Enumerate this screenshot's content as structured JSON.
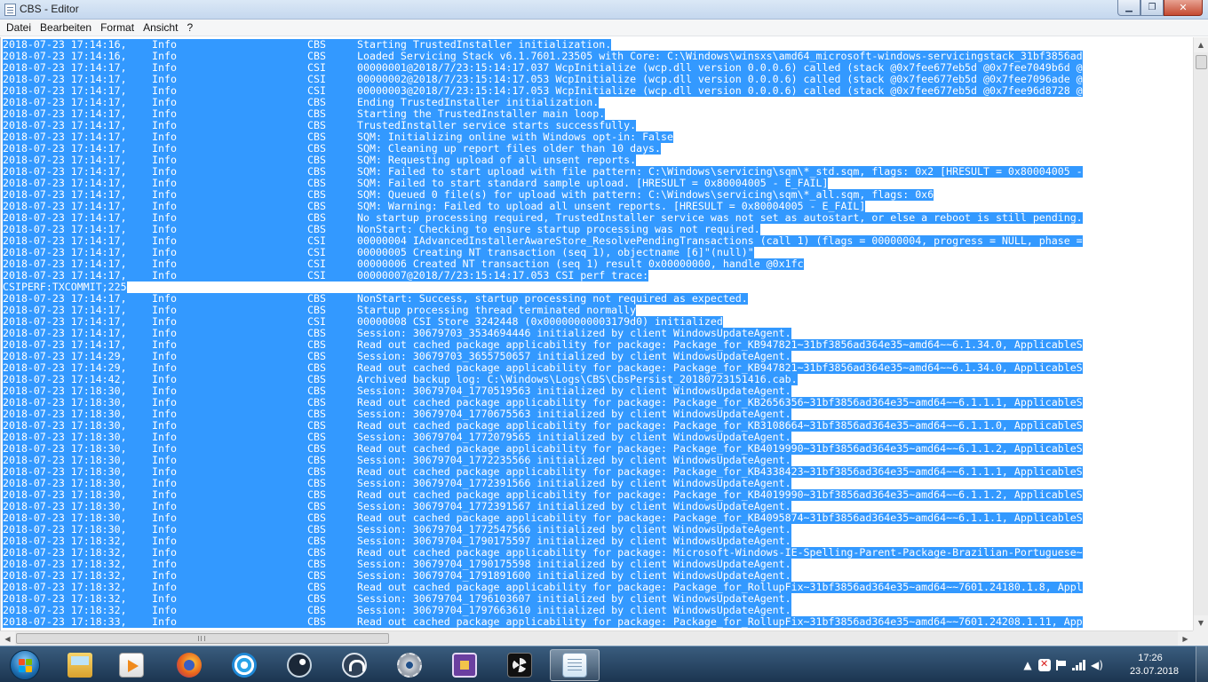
{
  "window": {
    "title": "CBS - Editor",
    "minimize_glyph": "▁",
    "maximize_glyph": "❐",
    "close_glyph": "✕"
  },
  "menu": {
    "items": [
      "Datei",
      "Bearbeiten",
      "Format",
      "Ansicht",
      "?"
    ]
  },
  "editor": {
    "selection_color": "#3399ff",
    "lines": [
      {
        "t": "2018-07-23 17:14:16,",
        "l": "Info",
        "c": "CBS",
        "m": "Starting TrustedInstaller initialization."
      },
      {
        "t": "2018-07-23 17:14:16,",
        "l": "Info",
        "c": "CBS",
        "m": "Loaded Servicing Stack v6.1.7601.23505 with Core: C:\\Windows\\winsxs\\amd64_microsoft-windows-servicingstack_31bf3856ad"
      },
      {
        "t": "2018-07-23 17:14:17,",
        "l": "Info",
        "c": "CSI",
        "m": "00000001@2018/7/23:15:14:17.037 WcpInitialize (wcp.dll version 0.0.0.6) called (stack @0x7fee677eb5d @0x7fee7049b6d @"
      },
      {
        "t": "2018-07-23 17:14:17,",
        "l": "Info",
        "c": "CSI",
        "m": "00000002@2018/7/23:15:14:17.053 WcpInitialize (wcp.dll version 0.0.0.6) called (stack @0x7fee677eb5d @0x7fee7096ade @"
      },
      {
        "t": "2018-07-23 17:14:17,",
        "l": "Info",
        "c": "CSI",
        "m": "00000003@2018/7/23:15:14:17.053 WcpInitialize (wcp.dll version 0.0.0.6) called (stack @0x7fee677eb5d @0x7fee96d8728 @"
      },
      {
        "t": "2018-07-23 17:14:17,",
        "l": "Info",
        "c": "CBS",
        "m": "Ending TrustedInstaller initialization."
      },
      {
        "t": "2018-07-23 17:14:17,",
        "l": "Info",
        "c": "CBS",
        "m": "Starting the TrustedInstaller main loop."
      },
      {
        "t": "2018-07-23 17:14:17,",
        "l": "Info",
        "c": "CBS",
        "m": "TrustedInstaller service starts successfully."
      },
      {
        "t": "2018-07-23 17:14:17,",
        "l": "Info",
        "c": "CBS",
        "m": "SQM: Initializing online with Windows opt-in: False"
      },
      {
        "t": "2018-07-23 17:14:17,",
        "l": "Info",
        "c": "CBS",
        "m": "SQM: Cleaning up report files older than 10 days."
      },
      {
        "t": "2018-07-23 17:14:17,",
        "l": "Info",
        "c": "CBS",
        "m": "SQM: Requesting upload of all unsent reports."
      },
      {
        "t": "2018-07-23 17:14:17,",
        "l": "Info",
        "c": "CBS",
        "m": "SQM: Failed to start upload with file pattern: C:\\Windows\\servicing\\sqm\\*_std.sqm, flags: 0x2 [HRESULT = 0x80004005 -"
      },
      {
        "t": "2018-07-23 17:14:17,",
        "l": "Info",
        "c": "CBS",
        "m": "SQM: Failed to start standard sample upload. [HRESULT = 0x80004005 - E_FAIL]"
      },
      {
        "t": "2018-07-23 17:14:17,",
        "l": "Info",
        "c": "CBS",
        "m": "SQM: Queued 0 file(s) for upload with pattern: C:\\Windows\\servicing\\sqm\\*_all.sqm, flags: 0x6"
      },
      {
        "t": "2018-07-23 17:14:17,",
        "l": "Info",
        "c": "CBS",
        "m": "SQM: Warning: Failed to upload all unsent reports. [HRESULT = 0x80004005 - E_FAIL]"
      },
      {
        "t": "2018-07-23 17:14:17,",
        "l": "Info",
        "c": "CBS",
        "m": "No startup processing required, TrustedInstaller service was not set as autostart, or else a reboot is still pending."
      },
      {
        "t": "2018-07-23 17:14:17,",
        "l": "Info",
        "c": "CBS",
        "m": "NonStart: Checking to ensure startup processing was not required."
      },
      {
        "t": "2018-07-23 17:14:17,",
        "l": "Info",
        "c": "CSI",
        "m": "00000004 IAdvancedInstallerAwareStore_ResolvePendingTransactions (call 1) (flags = 00000004, progress = NULL, phase ="
      },
      {
        "t": "2018-07-23 17:14:17,",
        "l": "Info",
        "c": "CSI",
        "m": "00000005 Creating NT transaction (seq 1), objectname [6]\"(null)\""
      },
      {
        "t": "2018-07-23 17:14:17,",
        "l": "Info",
        "c": "CSI",
        "m": "00000006 Created NT transaction (seq 1) result 0x00000000, handle @0x1fc"
      },
      {
        "t": "2018-07-23 17:14:17,",
        "l": "Info",
        "c": "CSI",
        "m": "00000007@2018/7/23:15:14:17.053 CSI perf trace:"
      },
      {
        "raw": "CSIPERF:TXCOMMIT;225"
      },
      {
        "t": "2018-07-23 17:14:17,",
        "l": "Info",
        "c": "CBS",
        "m": "NonStart: Success, startup processing not required as expected."
      },
      {
        "t": "2018-07-23 17:14:17,",
        "l": "Info",
        "c": "CBS",
        "m": "Startup processing thread terminated normally"
      },
      {
        "t": "2018-07-23 17:14:17,",
        "l": "Info",
        "c": "CSI",
        "m": "00000008 CSI Store 3242448 (0x00000000003179d0) initialized"
      },
      {
        "t": "2018-07-23 17:14:17,",
        "l": "Info",
        "c": "CBS",
        "m": "Session: 30679703_3534694446 initialized by client WindowsUpdateAgent."
      },
      {
        "t": "2018-07-23 17:14:17,",
        "l": "Info",
        "c": "CBS",
        "m": "Read out cached package applicability for package: Package_for_KB947821~31bf3856ad364e35~amd64~~6.1.34.0, ApplicableS"
      },
      {
        "t": "2018-07-23 17:14:29,",
        "l": "Info",
        "c": "CBS",
        "m": "Session: 30679703_3655750657 initialized by client WindowsUpdateAgent."
      },
      {
        "t": "2018-07-23 17:14:29,",
        "l": "Info",
        "c": "CBS",
        "m": "Read out cached package applicability for package: Package_for_KB947821~31bf3856ad364e35~amd64~~6.1.34.0, ApplicableS"
      },
      {
        "t": "2018-07-23 17:14:42,",
        "l": "Info",
        "c": "CBS",
        "m": "Archived backup log: C:\\Windows\\Logs\\CBS\\CbsPersist_20180723151416.cab."
      },
      {
        "t": "2018-07-23 17:18:30,",
        "l": "Info",
        "c": "CBS",
        "m": "Session: 30679704_1770519563 initialized by client WindowsUpdateAgent."
      },
      {
        "t": "2018-07-23 17:18:30,",
        "l": "Info",
        "c": "CBS",
        "m": "Read out cached package applicability for package: Package_for_KB2656356~31bf3856ad364e35~amd64~~6.1.1.1, ApplicableS"
      },
      {
        "t": "2018-07-23 17:18:30,",
        "l": "Info",
        "c": "CBS",
        "m": "Session: 30679704_1770675563 initialized by client WindowsUpdateAgent."
      },
      {
        "t": "2018-07-23 17:18:30,",
        "l": "Info",
        "c": "CBS",
        "m": "Read out cached package applicability for package: Package_for_KB3108664~31bf3856ad364e35~amd64~~6.1.1.0, ApplicableS"
      },
      {
        "t": "2018-07-23 17:18:30,",
        "l": "Info",
        "c": "CBS",
        "m": "Session: 30679704_1772079565 initialized by client WindowsUpdateAgent."
      },
      {
        "t": "2018-07-23 17:18:30,",
        "l": "Info",
        "c": "CBS",
        "m": "Read out cached package applicability for package: Package_for_KB4019990~31bf3856ad364e35~amd64~~6.1.1.2, ApplicableS"
      },
      {
        "t": "2018-07-23 17:18:30,",
        "l": "Info",
        "c": "CBS",
        "m": "Session: 30679704_1772235566 initialized by client WindowsUpdateAgent."
      },
      {
        "t": "2018-07-23 17:18:30,",
        "l": "Info",
        "c": "CBS",
        "m": "Read out cached package applicability for package: Package_for_KB4338423~31bf3856ad364e35~amd64~~6.1.1.1, ApplicableS"
      },
      {
        "t": "2018-07-23 17:18:30,",
        "l": "Info",
        "c": "CBS",
        "m": "Session: 30679704_1772391566 initialized by client WindowsUpdateAgent."
      },
      {
        "t": "2018-07-23 17:18:30,",
        "l": "Info",
        "c": "CBS",
        "m": "Read out cached package applicability for package: Package_for_KB4019990~31bf3856ad364e35~amd64~~6.1.1.2, ApplicableS"
      },
      {
        "t": "2018-07-23 17:18:30,",
        "l": "Info",
        "c": "CBS",
        "m": "Session: 30679704_1772391567 initialized by client WindowsUpdateAgent."
      },
      {
        "t": "2018-07-23 17:18:30,",
        "l": "Info",
        "c": "CBS",
        "m": "Read out cached package applicability for package: Package_for_KB4095874~31bf3856ad364e35~amd64~~6.1.1.1, ApplicableS"
      },
      {
        "t": "2018-07-23 17:18:30,",
        "l": "Info",
        "c": "CBS",
        "m": "Session: 30679704_1772547566 initialized by client WindowsUpdateAgent."
      },
      {
        "t": "2018-07-23 17:18:32,",
        "l": "Info",
        "c": "CBS",
        "m": "Session: 30679704_1790175597 initialized by client WindowsUpdateAgent."
      },
      {
        "t": "2018-07-23 17:18:32,",
        "l": "Info",
        "c": "CBS",
        "m": "Read out cached package applicability for package: Microsoft-Windows-IE-Spelling-Parent-Package-Brazilian-Portuguese~"
      },
      {
        "t": "2018-07-23 17:18:32,",
        "l": "Info",
        "c": "CBS",
        "m": "Session: 30679704_1790175598 initialized by client WindowsUpdateAgent."
      },
      {
        "t": "2018-07-23 17:18:32,",
        "l": "Info",
        "c": "CBS",
        "m": "Session: 30679704_1791891600 initialized by client WindowsUpdateAgent."
      },
      {
        "t": "2018-07-23 17:18:32,",
        "l": "Info",
        "c": "CBS",
        "m": "Read out cached package applicability for package: Package_for_RollupFix~31bf3856ad364e35~amd64~~7601.24180.1.8, Appl"
      },
      {
        "t": "2018-07-23 17:18:32,",
        "l": "Info",
        "c": "CBS",
        "m": "Session: 30679704_1796103607 initialized by client WindowsUpdateAgent."
      },
      {
        "t": "2018-07-23 17:18:32,",
        "l": "Info",
        "c": "CBS",
        "m": "Session: 30679704_1797663610 initialized by client WindowsUpdateAgent."
      },
      {
        "t": "2018-07-23 17:18:33,",
        "l": "Info",
        "c": "CBS",
        "m": "Read out cached package applicability for package: Package_for_RollupFix~31bf3856ad364e35~amd64~~7601.24208.1.11, App"
      }
    ]
  },
  "scrollbars": {
    "up_glyph": "▲",
    "down_glyph": "▼",
    "left_glyph": "◀",
    "right_glyph": "▶"
  },
  "taskbar": {
    "buttons": [
      {
        "name": "explorer",
        "icon": "folder-icon"
      },
      {
        "name": "media-player",
        "icon": "media-player-icon"
      },
      {
        "name": "firefox",
        "icon": "firefox-icon"
      },
      {
        "name": "uplay",
        "icon": "spiral-icon"
      },
      {
        "name": "steam",
        "icon": "steam-icon"
      },
      {
        "name": "headset-app",
        "icon": "headset-icon"
      },
      {
        "name": "settings-app",
        "icon": "gear-icon"
      },
      {
        "name": "cpu-app",
        "icon": "chip-icon"
      },
      {
        "name": "fan-app",
        "icon": "fan-icon"
      },
      {
        "name": "notepad",
        "icon": "notepad-icon",
        "active": true
      }
    ],
    "tray": {
      "expand_glyph": "▲",
      "clock_time": "17:26",
      "clock_date": "23.07.2018"
    }
  }
}
